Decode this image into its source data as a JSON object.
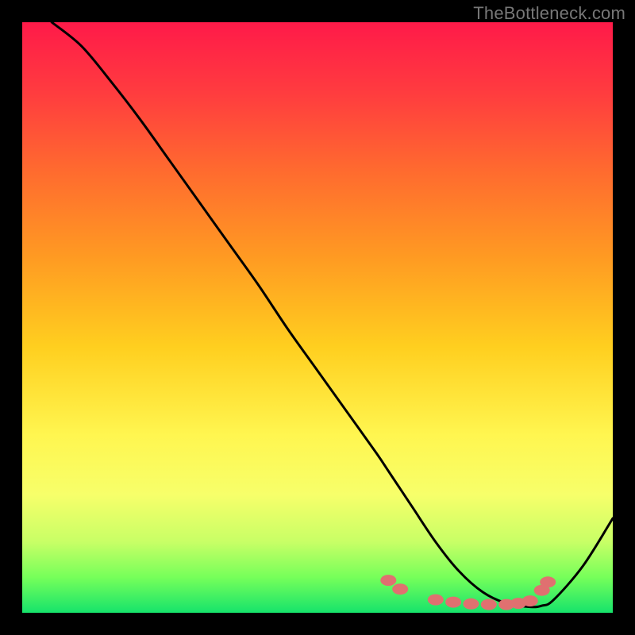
{
  "watermark": "TheBottleneck.com",
  "chart_data": {
    "type": "line",
    "title": "",
    "xlabel": "",
    "ylabel": "",
    "xlim": [
      0,
      100
    ],
    "ylim": [
      0,
      100
    ],
    "grid": false,
    "legend": false,
    "series": [
      {
        "name": "curve",
        "x": [
          5,
          10,
          15,
          20,
          25,
          30,
          35,
          40,
          45,
          50,
          55,
          60,
          62,
          64,
          66,
          70,
          74,
          78,
          82,
          86,
          88,
          90,
          95,
          100
        ],
        "values": [
          100,
          96,
          90,
          83.5,
          76.5,
          69.5,
          62.5,
          55.5,
          48,
          41,
          34,
          27,
          24,
          21,
          18,
          12,
          7,
          3.5,
          1.6,
          1.0,
          1.2,
          2.2,
          8,
          16
        ],
        "stroke": "#000000"
      }
    ],
    "markers": [
      {
        "x": 62,
        "y": 5.5
      },
      {
        "x": 64,
        "y": 4.0
      },
      {
        "x": 70,
        "y": 2.2
      },
      {
        "x": 73,
        "y": 1.8
      },
      {
        "x": 76,
        "y": 1.5
      },
      {
        "x": 79,
        "y": 1.4
      },
      {
        "x": 82,
        "y": 1.4
      },
      {
        "x": 84,
        "y": 1.6
      },
      {
        "x": 86,
        "y": 2.0
      },
      {
        "x": 88,
        "y": 3.8
      },
      {
        "x": 89,
        "y": 5.2
      }
    ],
    "marker_color": "#e07070",
    "gradient_stops": [
      {
        "pos": 0.0,
        "color": "#ff1a49"
      },
      {
        "pos": 0.94,
        "color": "#76ff5a"
      },
      {
        "pos": 1.0,
        "color": "#16e36b"
      }
    ]
  }
}
